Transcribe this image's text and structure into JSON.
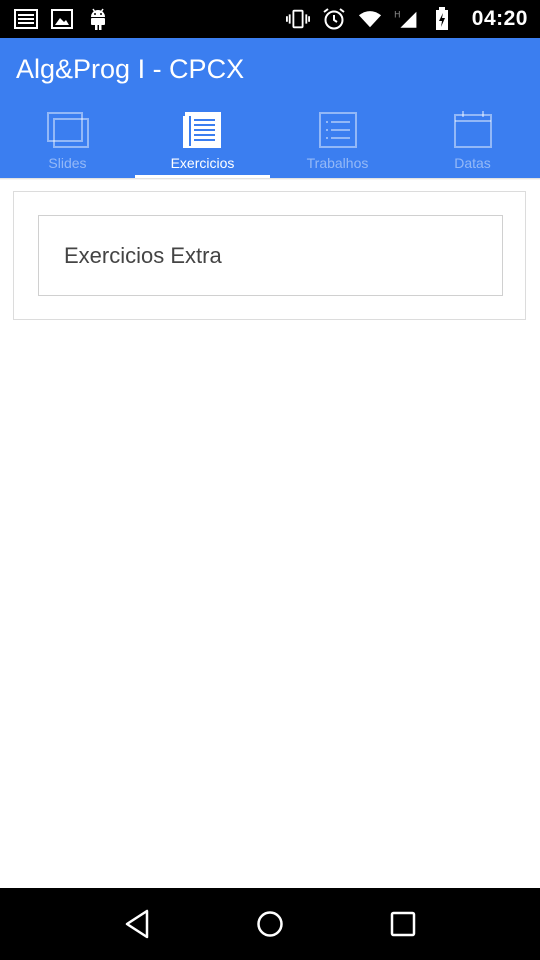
{
  "status_bar": {
    "time": "04:20",
    "left_icons": [
      "notes-icon",
      "image-icon",
      "android-icon"
    ],
    "right_icons": [
      "vibrate-icon",
      "alarm-icon",
      "wifi-icon",
      "h-signal-icon",
      "battery-icon"
    ],
    "network_type": "H"
  },
  "app": {
    "title": "Alg&Prog I - CPCX",
    "accent_color": "#3b7ef0"
  },
  "tabs": [
    {
      "label": "Slides",
      "icon": "slides-icon",
      "active": false
    },
    {
      "label": "Exercicios",
      "icon": "document-icon",
      "active": true
    },
    {
      "label": "Trabalhos",
      "icon": "list-icon",
      "active": false
    },
    {
      "label": "Datas",
      "icon": "calendar-icon",
      "active": false
    }
  ],
  "content": {
    "items": [
      {
        "label": "Exercicios Extra"
      }
    ]
  },
  "nav_bar": {
    "buttons": [
      "back-icon",
      "home-icon",
      "recents-icon"
    ]
  }
}
